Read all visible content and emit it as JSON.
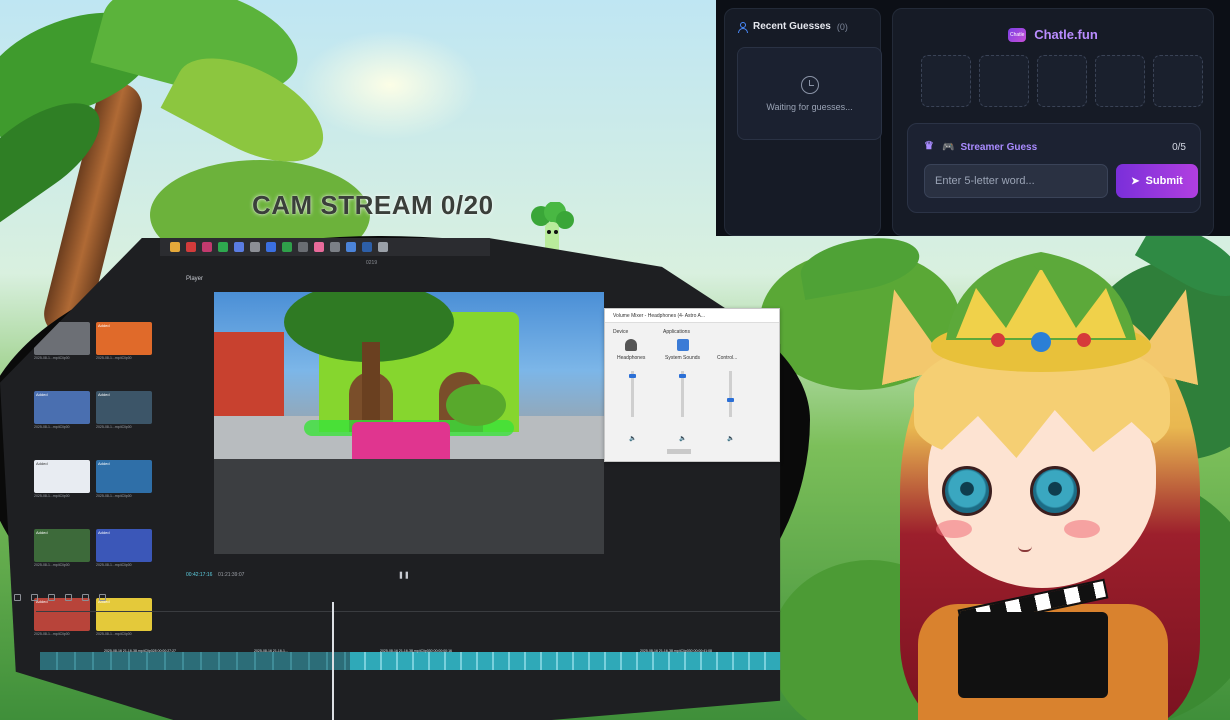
{
  "colors": {
    "overlay_bg": "#0c0f16",
    "panel_bg": "#161b26",
    "accent_purple": "#b98cff",
    "submit_gradient_start": "#7a2fd9",
    "submit_gradient_end": "#b13fe0",
    "timeline_selected": "#2fa9b8"
  },
  "recent_guesses": {
    "title": "Recent Guesses",
    "count": "(0)",
    "icon": "users-icon",
    "empty_icon": "clock-icon",
    "empty_text": "Waiting for guesses..."
  },
  "game": {
    "brand_logo_text": "Chatle",
    "brand_name": "Chatle.fun",
    "tiles": [
      "",
      "",
      "",
      "",
      ""
    ],
    "streamer": {
      "title": "Streamer Guess",
      "icons": [
        "crown-icon",
        "gamepad-icon"
      ],
      "count": "0/5",
      "input_value": "",
      "input_placeholder": "Enter 5-letter word...",
      "submit_label": "Submit",
      "submit_icon": "send-icon"
    }
  },
  "stream": {
    "cam_label": "CAM STREAM 0/20"
  },
  "editor": {
    "project_name": "0219",
    "player_tab": "Player",
    "clip_badge": "Added",
    "clip_name": "2025-08-1...mp4Clip00",
    "current_time": "00:42:17:16",
    "total_time": "01:21:39:07",
    "track_labels": [
      "2025-08-16 21-16-38.mp4Clip028  00:00:27:27",
      "2025-08-16 21-16-1...",
      "2025-08-16 21-16-38.mp4Clip030  00:00:00:16",
      "2025-08-16 21-16-38.mp4Clip030  00:00:41:08"
    ]
  },
  "volume_mixer": {
    "title": "Volume Mixer - Headphones (4- Astro A...",
    "device_label": "Device",
    "applications_label": "Applications",
    "channels": [
      {
        "label": "Headphones",
        "level": 0.92
      },
      {
        "label": "System Sounds",
        "level": 0.92
      },
      {
        "label": "Control...",
        "level": 0.35
      }
    ]
  },
  "avatar": {
    "sign_text": ""
  }
}
